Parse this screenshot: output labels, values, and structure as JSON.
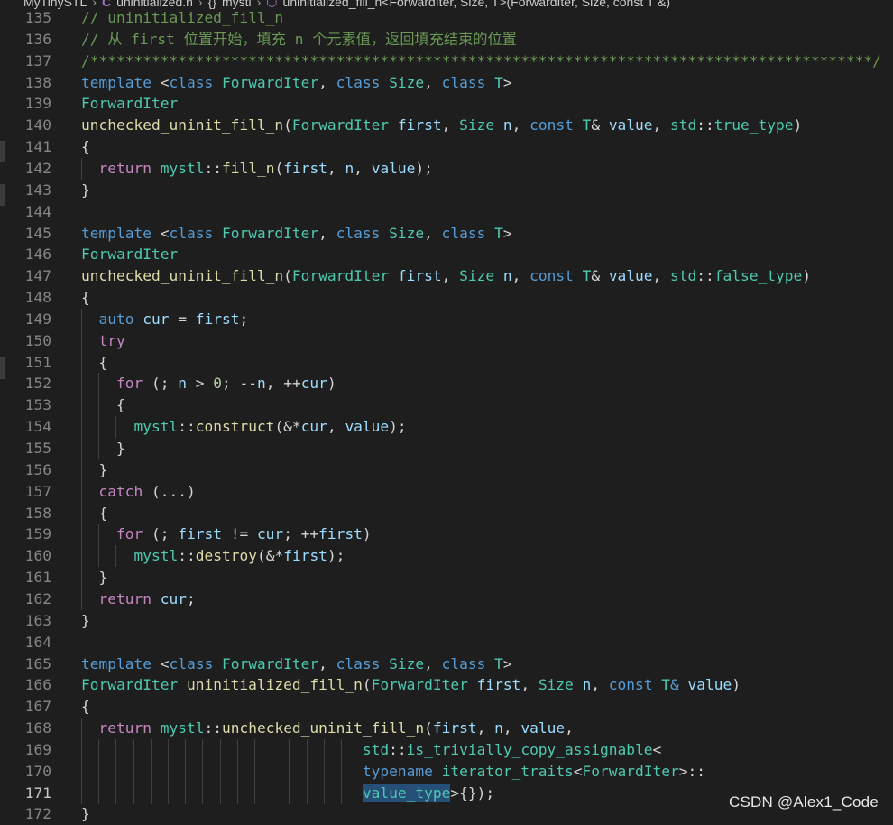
{
  "breadcrumb": {
    "project": "MyTinySTL",
    "file": "uninitialized.h",
    "namespace_icon": "braces-icon",
    "namespace": "mystl",
    "function_icon": "cube-icon",
    "function": "uninitialized_fill_n<ForwardIter, Size, T>(ForwardIter, Size, const T &)"
  },
  "watermark": "CSDN @Alex1_Code",
  "active_line": 171,
  "colors": {
    "background": "#1e1e1e",
    "keyword": "#569cd6",
    "control": "#c586c0",
    "type": "#4ec9b0",
    "function": "#dcdcaa",
    "variable": "#9cdcfe",
    "comment": "#6a9955",
    "number": "#b5cea8"
  },
  "lines": [
    {
      "num": "135",
      "tokens": [
        [
          "c",
          "// uninitialized_fill_n"
        ]
      ]
    },
    {
      "num": "136",
      "tokens": [
        [
          "c",
          "// 从 first 位置开始，填充 n 个元素值，返回填充结束的位置"
        ]
      ]
    },
    {
      "num": "137",
      "tokens": [
        [
          "c",
          "/*****************************************************************************************/"
        ]
      ]
    },
    {
      "num": "138",
      "tokens": [
        [
          "k",
          "template "
        ],
        [
          "o",
          "<"
        ],
        [
          "k",
          "class "
        ],
        [
          "t",
          "ForwardIter"
        ],
        [
          "o",
          ", "
        ],
        [
          "k",
          "class "
        ],
        [
          "t",
          "Size"
        ],
        [
          "o",
          ", "
        ],
        [
          "k",
          "class "
        ],
        [
          "t",
          "T"
        ],
        [
          "o",
          ">"
        ]
      ]
    },
    {
      "num": "139",
      "tokens": [
        [
          "t",
          "ForwardIter"
        ]
      ]
    },
    {
      "num": "140",
      "tokens": [
        [
          "f",
          "unchecked_uninit_fill_n"
        ],
        [
          "o",
          "("
        ],
        [
          "t",
          "ForwardIter "
        ],
        [
          "v",
          "first"
        ],
        [
          "o",
          ", "
        ],
        [
          "t",
          "Size "
        ],
        [
          "v",
          "n"
        ],
        [
          "o",
          ", "
        ],
        [
          "k",
          "const "
        ],
        [
          "t",
          "T"
        ],
        [
          "o",
          "& "
        ],
        [
          "v",
          "value"
        ],
        [
          "o",
          ", "
        ],
        [
          "t",
          "std"
        ],
        [
          "o",
          "::"
        ],
        [
          "t",
          "true_type"
        ],
        [
          "o",
          ")"
        ]
      ]
    },
    {
      "num": "141",
      "tokens": [
        [
          "o",
          "{"
        ]
      ]
    },
    {
      "num": "142",
      "tokens": [
        [
          "o",
          "  "
        ],
        [
          "kc",
          "return "
        ],
        [
          "t",
          "mystl"
        ],
        [
          "o",
          "::"
        ],
        [
          "f",
          "fill_n"
        ],
        [
          "o",
          "("
        ],
        [
          "v",
          "first"
        ],
        [
          "o",
          ", "
        ],
        [
          "v",
          "n"
        ],
        [
          "o",
          ", "
        ],
        [
          "v",
          "value"
        ],
        [
          "o",
          ");"
        ]
      ]
    },
    {
      "num": "143",
      "tokens": [
        [
          "o",
          "}"
        ]
      ]
    },
    {
      "num": "144",
      "tokens": []
    },
    {
      "num": "145",
      "tokens": [
        [
          "k",
          "template "
        ],
        [
          "o",
          "<"
        ],
        [
          "k",
          "class "
        ],
        [
          "t",
          "ForwardIter"
        ],
        [
          "o",
          ", "
        ],
        [
          "k",
          "class "
        ],
        [
          "t",
          "Size"
        ],
        [
          "o",
          ", "
        ],
        [
          "k",
          "class "
        ],
        [
          "t",
          "T"
        ],
        [
          "o",
          ">"
        ]
      ]
    },
    {
      "num": "146",
      "tokens": [
        [
          "t",
          "ForwardIter"
        ]
      ]
    },
    {
      "num": "147",
      "tokens": [
        [
          "f",
          "unchecked_uninit_fill_n"
        ],
        [
          "o",
          "("
        ],
        [
          "t",
          "ForwardIter "
        ],
        [
          "v",
          "first"
        ],
        [
          "o",
          ", "
        ],
        [
          "t",
          "Size "
        ],
        [
          "v",
          "n"
        ],
        [
          "o",
          ", "
        ],
        [
          "k",
          "const "
        ],
        [
          "t",
          "T"
        ],
        [
          "o",
          "& "
        ],
        [
          "v",
          "value"
        ],
        [
          "o",
          ", "
        ],
        [
          "t",
          "std"
        ],
        [
          "o",
          "::"
        ],
        [
          "t",
          "false_type"
        ],
        [
          "o",
          ")"
        ]
      ]
    },
    {
      "num": "148",
      "tokens": [
        [
          "o",
          "{"
        ]
      ]
    },
    {
      "num": "149",
      "tokens": [
        [
          "o",
          "  "
        ],
        [
          "k",
          "auto "
        ],
        [
          "v",
          "cur"
        ],
        [
          "o",
          " = "
        ],
        [
          "v",
          "first"
        ],
        [
          "o",
          ";"
        ]
      ]
    },
    {
      "num": "150",
      "tokens": [
        [
          "o",
          "  "
        ],
        [
          "kc",
          "try"
        ]
      ]
    },
    {
      "num": "151",
      "tokens": [
        [
          "o",
          "  {"
        ]
      ]
    },
    {
      "num": "152",
      "tokens": [
        [
          "o",
          "    "
        ],
        [
          "kc",
          "for "
        ],
        [
          "o",
          "(; "
        ],
        [
          "v",
          "n"
        ],
        [
          "o",
          " > "
        ],
        [
          "n",
          "0"
        ],
        [
          "o",
          "; --"
        ],
        [
          "v",
          "n"
        ],
        [
          "o",
          ", ++"
        ],
        [
          "v",
          "cur"
        ],
        [
          "o",
          ")"
        ]
      ]
    },
    {
      "num": "153",
      "tokens": [
        [
          "o",
          "    {"
        ]
      ]
    },
    {
      "num": "154",
      "tokens": [
        [
          "o",
          "      "
        ],
        [
          "t",
          "mystl"
        ],
        [
          "o",
          "::"
        ],
        [
          "f",
          "construct"
        ],
        [
          "o",
          "(&*"
        ],
        [
          "v",
          "cur"
        ],
        [
          "o",
          ", "
        ],
        [
          "v",
          "value"
        ],
        [
          "o",
          ");"
        ]
      ]
    },
    {
      "num": "155",
      "tokens": [
        [
          "o",
          "    }"
        ]
      ]
    },
    {
      "num": "156",
      "tokens": [
        [
          "o",
          "  }"
        ]
      ]
    },
    {
      "num": "157",
      "tokens": [
        [
          "o",
          "  "
        ],
        [
          "kc",
          "catch "
        ],
        [
          "o",
          "(...)"
        ]
      ]
    },
    {
      "num": "158",
      "tokens": [
        [
          "o",
          "  {"
        ]
      ]
    },
    {
      "num": "159",
      "tokens": [
        [
          "o",
          "    "
        ],
        [
          "kc",
          "for "
        ],
        [
          "o",
          "(; "
        ],
        [
          "v",
          "first"
        ],
        [
          "o",
          " != "
        ],
        [
          "v",
          "cur"
        ],
        [
          "o",
          "; ++"
        ],
        [
          "v",
          "first"
        ],
        [
          "o",
          ")"
        ]
      ]
    },
    {
      "num": "160",
      "tokens": [
        [
          "o",
          "      "
        ],
        [
          "t",
          "mystl"
        ],
        [
          "o",
          "::"
        ],
        [
          "f",
          "destroy"
        ],
        [
          "o",
          "(&*"
        ],
        [
          "v",
          "first"
        ],
        [
          "o",
          ");"
        ]
      ]
    },
    {
      "num": "161",
      "tokens": [
        [
          "o",
          "  }"
        ]
      ]
    },
    {
      "num": "162",
      "tokens": [
        [
          "o",
          "  "
        ],
        [
          "kc",
          "return "
        ],
        [
          "v",
          "cur"
        ],
        [
          "o",
          ";"
        ]
      ]
    },
    {
      "num": "163",
      "tokens": [
        [
          "o",
          "}"
        ]
      ]
    },
    {
      "num": "164",
      "tokens": []
    },
    {
      "num": "165",
      "tokens": [
        [
          "k",
          "template "
        ],
        [
          "o",
          "<"
        ],
        [
          "k",
          "class "
        ],
        [
          "t",
          "ForwardIter"
        ],
        [
          "o",
          ", "
        ],
        [
          "k",
          "class "
        ],
        [
          "t",
          "Size"
        ],
        [
          "o",
          ", "
        ],
        [
          "k",
          "class "
        ],
        [
          "t",
          "T"
        ],
        [
          "o",
          ">"
        ]
      ]
    },
    {
      "num": "166",
      "tokens": [
        [
          "t",
          "ForwardIter "
        ],
        [
          "f",
          "uninitialized_fill_n"
        ],
        [
          "o",
          "("
        ],
        [
          "t",
          "ForwardIter "
        ],
        [
          "v",
          "first"
        ],
        [
          "o",
          ", "
        ],
        [
          "t",
          "Size "
        ],
        [
          "v",
          "n"
        ],
        [
          "o",
          ", "
        ],
        [
          "k",
          "const "
        ],
        [
          "t",
          "T"
        ],
        [
          "k",
          "& "
        ],
        [
          "v",
          "value"
        ],
        [
          "o",
          ")"
        ]
      ]
    },
    {
      "num": "167",
      "tokens": [
        [
          "o",
          "{"
        ]
      ]
    },
    {
      "num": "168",
      "tokens": [
        [
          "o",
          "  "
        ],
        [
          "kc",
          "return "
        ],
        [
          "t",
          "mystl"
        ],
        [
          "o",
          "::"
        ],
        [
          "f",
          "unchecked_uninit_fill_n"
        ],
        [
          "o",
          "("
        ],
        [
          "v",
          "first"
        ],
        [
          "o",
          ", "
        ],
        [
          "v",
          "n"
        ],
        [
          "o",
          ", "
        ],
        [
          "v",
          "value"
        ],
        [
          "o",
          ","
        ]
      ]
    },
    {
      "num": "169",
      "tokens": [
        [
          "o",
          "                                "
        ],
        [
          "t",
          "std"
        ],
        [
          "o",
          "::"
        ],
        [
          "t",
          "is_trivially_copy_assignable"
        ],
        [
          "o",
          "<"
        ]
      ]
    },
    {
      "num": "170",
      "tokens": [
        [
          "o",
          "                                "
        ],
        [
          "k",
          "typename "
        ],
        [
          "t",
          "iterator_traits"
        ],
        [
          "o",
          "<"
        ],
        [
          "t",
          "ForwardIter"
        ],
        [
          "o",
          ">::"
        ]
      ]
    },
    {
      "num": "171",
      "tokens": [
        [
          "o",
          "                                "
        ],
        [
          "t sel",
          "value_type"
        ],
        [
          "o",
          ">{});"
        ]
      ]
    },
    {
      "num": "172",
      "tokens": [
        [
          "o",
          "}"
        ]
      ]
    }
  ]
}
